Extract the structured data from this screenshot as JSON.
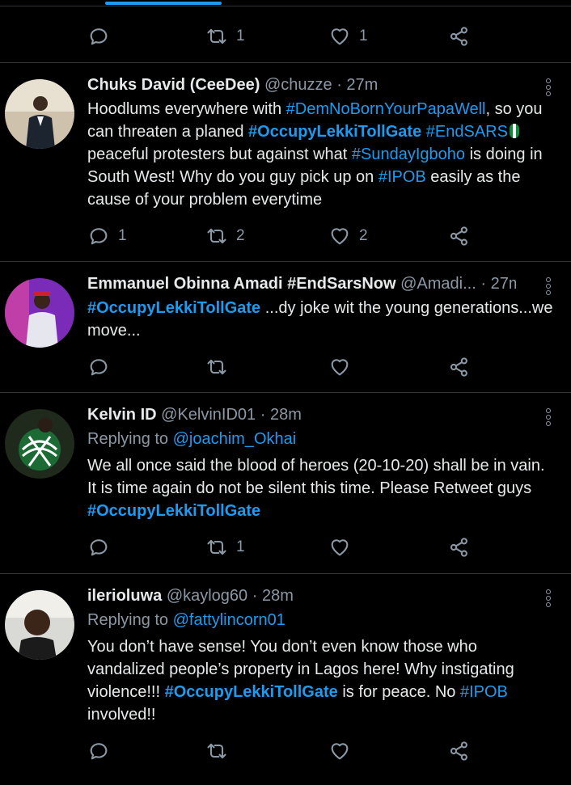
{
  "top_actions": {
    "reply_count": "",
    "retweet_count": "1",
    "like_count": "1"
  },
  "tweets": [
    {
      "name": "Chuks David (CeeDee)",
      "handle": "@chuzze",
      "time": "· 27m",
      "body": {
        "t1": "Hoodlums everywhere with ",
        "h1": "#DemNoBornYourPapaWell",
        "t2": ", so you can threaten a planed ",
        "h2": "#OccupyLekkiTollGate",
        "t3": " ",
        "h3": "#EndSARS",
        "t4": "  peaceful protesters but against what ",
        "h4": "#SundayIgboho",
        "t5": " is doing in South West! Why do you guy pick up on ",
        "h5": "#IPOB",
        "t6": " easily as the cause of your problem everytime"
      },
      "reply_count": "1",
      "retweet_count": "2",
      "like_count": "2"
    },
    {
      "name": "Emmanuel Obinna Amadi #EndSarsNow",
      "handle": "@Amadi...",
      "time": "· 27m",
      "body": {
        "h1": "#OccupyLekkiTollGate",
        "t1": " ...dy joke wit the young generations...we move..."
      },
      "reply_count": "",
      "retweet_count": "",
      "like_count": ""
    },
    {
      "name": "Kelvin ID",
      "handle": "@KelvinID01",
      "time": "· 28m",
      "replying_label": "Replying to",
      "replying_to": "@joachim_Okhai",
      "body": {
        "t1": "We all once said the blood of heroes (20-10-20)  shall be in vain. It is time again do not be silent this time. Please Retweet guys ",
        "h1": "#OccupyLekkiTollGate"
      },
      "reply_count": "",
      "retweet_count": "1",
      "like_count": ""
    },
    {
      "name": "ilerioluwa",
      "handle": "@kaylog60",
      "time": "· 28m",
      "replying_label": "Replying to",
      "replying_to": "@fattylincorn01",
      "body": {
        "t1": "You don’t have sense! You don’t even know those who vandalized people’s property in Lagos here! Why instigating violence!!! ",
        "h1": "#OccupyLekkiTollGate",
        "t2": " is for peace. No ",
        "h2": "#IPOB",
        "t3": " involved!!"
      },
      "reply_count": "",
      "retweet_count": "",
      "like_count": ""
    }
  ],
  "icons": {
    "reply": "reply-icon",
    "retweet": "retweet-icon",
    "like": "heart-icon",
    "share": "share-icon",
    "more": "more-vertical-icon"
  },
  "colors": {
    "background": "#000000",
    "accent": "#1d9bf0",
    "muted": "#8b98a5",
    "divider": "#2f3336"
  }
}
